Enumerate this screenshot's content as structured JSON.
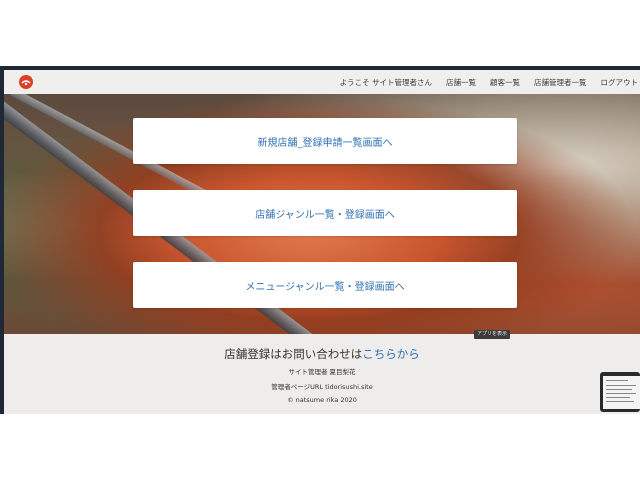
{
  "navbar": {
    "greeting": "ようこそ サイト管理者さん",
    "links": [
      "店舗一覧",
      "顧客一覧",
      "店舗管理者一覧",
      "ログアウト"
    ]
  },
  "main": {
    "buttons": [
      "新規店舗_登録申請一覧画面へ",
      "店舗ジャンル一覧・登録画面へ",
      "メニュージャンル一覧・登録画面へ"
    ],
    "app_badge": "アプリを表示"
  },
  "footer": {
    "title_prefix": "店舗登録はお問い合わせは",
    "title_link": "こちらから",
    "admin": "サイト管理者 夏目梨花",
    "admin_page": "管理者ページURL tidorisushi.site",
    "copyright": "© natsume rika 2020"
  },
  "colors": {
    "accent": "#2f6fb3",
    "logo": "#d9412b"
  }
}
